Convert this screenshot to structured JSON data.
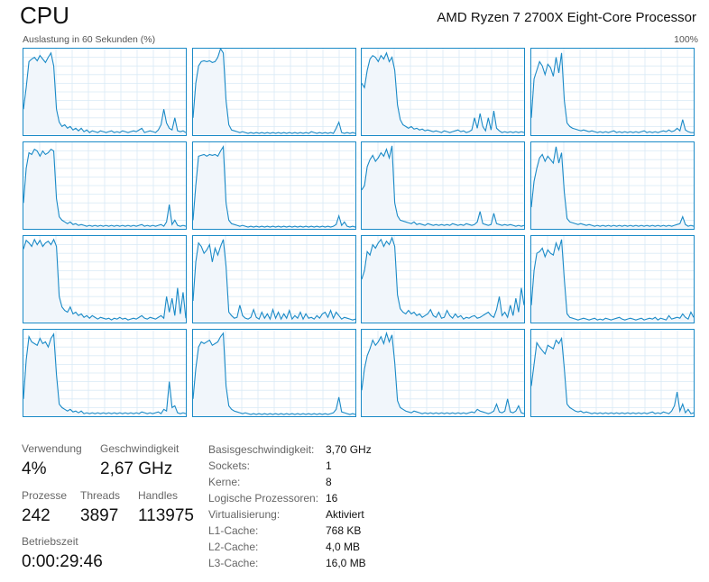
{
  "header": {
    "title": "CPU",
    "processor": "AMD Ryzen 7 2700X Eight-Core Processor",
    "axis_label": "Auslastung in 60 Sekunden (%)",
    "axis_max": "100%"
  },
  "colors": {
    "line": "#1a8ac7",
    "fill": "#f1f6fb",
    "grid": "#d9eaf5",
    "border": "#1a8ac7"
  },
  "stats": {
    "usage_label": "Verwendung",
    "usage_value": "4%",
    "speed_label": "Geschwindigkeit",
    "speed_value": "2,67 GHz",
    "processes_label": "Prozesse",
    "processes_value": "242",
    "threads_label": "Threads",
    "threads_value": "3897",
    "handles_label": "Handles",
    "handles_value": "113975",
    "uptime_label": "Betriebszeit",
    "uptime_value": "0:00:29:46"
  },
  "details": [
    {
      "label": "Basisgeschwindigkeit:",
      "value": "3,70 GHz"
    },
    {
      "label": "Sockets:",
      "value": "1"
    },
    {
      "label": "Kerne:",
      "value": "8"
    },
    {
      "label": "Logische Prozessoren:",
      "value": "16"
    },
    {
      "label": "Virtualisierung:",
      "value": "Aktiviert"
    },
    {
      "label": "L1-Cache:",
      "value": "768 KB"
    },
    {
      "label": "L2-Cache:",
      "value": "4,0 MB"
    },
    {
      "label": "L3-Cache:",
      "value": "16,0 MB"
    }
  ],
  "chart_data": {
    "type": "area",
    "ylim": [
      0,
      100
    ],
    "x_seconds": 60,
    "grid": true,
    "series": [
      {
        "values": [
          30,
          55,
          85,
          88,
          90,
          86,
          92,
          88,
          84,
          90,
          95,
          80,
          30,
          15,
          10,
          12,
          8,
          10,
          6,
          8,
          5,
          8,
          4,
          6,
          3,
          5,
          4,
          3,
          5,
          4,
          3,
          4,
          5,
          3,
          4,
          3,
          5,
          4,
          3,
          4,
          5,
          4,
          6,
          8,
          3,
          4,
          5,
          4,
          3,
          6,
          12,
          30,
          14,
          8,
          6,
          20,
          5,
          4,
          5,
          3
        ]
      },
      {
        "values": [
          20,
          60,
          80,
          85,
          86,
          85,
          86,
          84,
          85,
          90,
          100,
          95,
          40,
          12,
          6,
          5,
          4,
          3,
          4,
          3,
          2,
          3,
          2,
          3,
          2,
          3,
          2,
          3,
          2,
          3,
          2,
          3,
          2,
          3,
          2,
          3,
          2,
          3,
          2,
          3,
          2,
          3,
          2,
          4,
          3,
          2,
          3,
          2,
          3,
          2,
          3,
          2,
          8,
          15,
          3,
          2,
          3,
          2,
          3,
          2
        ]
      },
      {
        "values": [
          60,
          55,
          75,
          88,
          92,
          90,
          85,
          92,
          88,
          95,
          85,
          90,
          75,
          35,
          18,
          12,
          10,
          8,
          10,
          7,
          8,
          6,
          7,
          5,
          6,
          5,
          4,
          5,
          4,
          3,
          5,
          4,
          3,
          4,
          5,
          6,
          4,
          5,
          3,
          4,
          6,
          20,
          8,
          25,
          10,
          5,
          20,
          6,
          28,
          8,
          5,
          3,
          4,
          3,
          4,
          3,
          4,
          3,
          4,
          3
        ]
      },
      {
        "values": [
          20,
          65,
          75,
          85,
          80,
          70,
          82,
          78,
          68,
          90,
          72,
          95,
          40,
          14,
          10,
          8,
          7,
          6,
          5,
          6,
          5,
          4,
          5,
          4,
          3,
          4,
          3,
          4,
          3,
          4,
          5,
          3,
          4,
          3,
          4,
          3,
          4,
          3,
          4,
          3,
          4,
          5,
          3,
          4,
          3,
          4,
          3,
          4,
          5,
          4,
          6,
          4,
          5,
          8,
          5,
          18,
          6,
          4,
          3,
          3
        ]
      },
      {
        "values": [
          30,
          70,
          88,
          86,
          92,
          90,
          84,
          90,
          86,
          88,
          92,
          90,
          35,
          14,
          10,
          8,
          6,
          8,
          5,
          6,
          4,
          5,
          4,
          3,
          4,
          3,
          4,
          3,
          4,
          3,
          4,
          3,
          4,
          3,
          4,
          3,
          4,
          3,
          4,
          3,
          4,
          3,
          4,
          5,
          3,
          4,
          3,
          4,
          3,
          4,
          5,
          3,
          8,
          28,
          5,
          10,
          4,
          3,
          4,
          3
        ]
      },
      {
        "values": [
          10,
          50,
          84,
          85,
          86,
          84,
          86,
          85,
          86,
          84,
          90,
          95,
          30,
          10,
          6,
          5,
          4,
          3,
          4,
          3,
          2,
          3,
          2,
          3,
          2,
          3,
          2,
          3,
          2,
          3,
          2,
          3,
          2,
          3,
          2,
          3,
          2,
          3,
          2,
          3,
          2,
          3,
          2,
          3,
          2,
          3,
          2,
          3,
          2,
          3,
          2,
          3,
          5,
          15,
          4,
          8,
          3,
          2,
          3,
          2
        ]
      },
      {
        "values": [
          45,
          50,
          72,
          80,
          85,
          78,
          82,
          88,
          84,
          92,
          82,
          96,
          30,
          15,
          10,
          9,
          8,
          7,
          6,
          8,
          5,
          6,
          5,
          4,
          6,
          5,
          4,
          5,
          4,
          5,
          4,
          5,
          4,
          6,
          5,
          4,
          5,
          4,
          6,
          5,
          4,
          5,
          8,
          20,
          6,
          5,
          4,
          5,
          18,
          6,
          5,
          4,
          5,
          4,
          5,
          4,
          3,
          4,
          3,
          4
        ]
      },
      {
        "values": [
          25,
          55,
          70,
          82,
          86,
          78,
          84,
          80,
          76,
          95,
          76,
          88,
          42,
          12,
          8,
          7,
          6,
          5,
          6,
          5,
          4,
          5,
          4,
          3,
          4,
          3,
          4,
          3,
          4,
          3,
          4,
          3,
          4,
          3,
          4,
          3,
          4,
          3,
          4,
          3,
          4,
          3,
          4,
          3,
          4,
          3,
          4,
          3,
          4,
          3,
          4,
          3,
          4,
          5,
          6,
          14,
          5,
          3,
          4,
          3
        ]
      },
      {
        "values": [
          85,
          95,
          92,
          88,
          96,
          90,
          95,
          88,
          92,
          94,
          90,
          96,
          88,
          30,
          18,
          14,
          12,
          18,
          10,
          12,
          8,
          10,
          6,
          8,
          5,
          8,
          6,
          4,
          6,
          5,
          4,
          5,
          3,
          5,
          4,
          6,
          4,
          5,
          3,
          4,
          5,
          4,
          6,
          8,
          5,
          4,
          6,
          5,
          4,
          6,
          8,
          5,
          30,
          12,
          28,
          8,
          40,
          10,
          35,
          5
        ]
      },
      {
        "values": [
          25,
          70,
          92,
          88,
          80,
          84,
          90,
          70,
          86,
          78,
          88,
          96,
          65,
          12,
          8,
          5,
          6,
          20,
          8,
          5,
          4,
          6,
          15,
          6,
          4,
          12,
          5,
          10,
          4,
          15,
          5,
          12,
          4,
          10,
          5,
          14,
          4,
          8,
          5,
          12,
          4,
          10,
          5,
          6,
          4,
          8,
          5,
          10,
          12,
          6,
          14,
          5,
          12,
          8,
          4,
          6,
          5,
          4,
          3,
          4
        ]
      },
      {
        "values": [
          50,
          60,
          82,
          78,
          90,
          86,
          92,
          96,
          88,
          94,
          90,
          98,
          88,
          32,
          16,
          12,
          10,
          14,
          10,
          12,
          8,
          10,
          6,
          8,
          10,
          15,
          8,
          6,
          12,
          5,
          6,
          14,
          8,
          5,
          10,
          6,
          8,
          4,
          6,
          5,
          7,
          8,
          5,
          6,
          8,
          10,
          12,
          8,
          6,
          15,
          30,
          8,
          12,
          6,
          20,
          8,
          28,
          12,
          40,
          20
        ]
      },
      {
        "values": [
          20,
          60,
          80,
          82,
          86,
          76,
          84,
          80,
          78,
          92,
          84,
          96,
          50,
          10,
          6,
          5,
          4,
          3,
          4,
          5,
          4,
          3,
          4,
          5,
          3,
          4,
          3,
          5,
          4,
          3,
          4,
          5,
          6,
          4,
          3,
          4,
          5,
          4,
          3,
          4,
          5,
          3,
          4,
          5,
          4,
          6,
          3,
          5,
          4,
          3,
          8,
          4,
          5,
          6,
          5,
          10,
          6,
          4,
          12,
          6
        ]
      },
      {
        "values": [
          20,
          65,
          92,
          86,
          84,
          82,
          90,
          84,
          86,
          80,
          90,
          95,
          48,
          14,
          10,
          8,
          6,
          8,
          5,
          6,
          4,
          6,
          3,
          4,
          3,
          4,
          3,
          4,
          3,
          4,
          3,
          4,
          3,
          4,
          3,
          4,
          3,
          4,
          3,
          4,
          3,
          4,
          3,
          5,
          4,
          3,
          4,
          3,
          4,
          5,
          3,
          8,
          6,
          40,
          10,
          12,
          4,
          3,
          4,
          3
        ]
      },
      {
        "values": [
          20,
          55,
          80,
          86,
          84,
          86,
          88,
          82,
          84,
          86,
          92,
          96,
          35,
          12,
          8,
          6,
          5,
          4,
          3,
          4,
          3,
          2,
          3,
          2,
          3,
          2,
          3,
          2,
          3,
          2,
          3,
          2,
          3,
          2,
          3,
          2,
          3,
          2,
          3,
          2,
          3,
          2,
          3,
          2,
          3,
          2,
          3,
          2,
          3,
          2,
          3,
          4,
          8,
          22,
          5,
          4,
          3,
          2,
          3,
          2
        ]
      },
      {
        "values": [
          30,
          55,
          70,
          78,
          88,
          82,
          86,
          92,
          84,
          96,
          86,
          94,
          62,
          18,
          10,
          8,
          6,
          5,
          4,
          6,
          5,
          4,
          3,
          4,
          3,
          4,
          3,
          4,
          3,
          4,
          3,
          4,
          3,
          4,
          3,
          4,
          3,
          4,
          3,
          4,
          5,
          4,
          8,
          6,
          5,
          4,
          3,
          4,
          6,
          14,
          5,
          4,
          6,
          20,
          5,
          4,
          6,
          12,
          4,
          3
        ]
      },
      {
        "values": [
          35,
          60,
          85,
          80,
          76,
          72,
          82,
          80,
          78,
          88,
          84,
          90,
          55,
          14,
          10,
          8,
          6,
          5,
          6,
          4,
          5,
          4,
          3,
          4,
          3,
          4,
          3,
          4,
          3,
          4,
          3,
          4,
          3,
          4,
          3,
          4,
          3,
          4,
          3,
          4,
          3,
          4,
          3,
          4,
          5,
          3,
          4,
          3,
          5,
          4,
          3,
          6,
          12,
          28,
          6,
          14,
          4,
          8,
          3,
          4
        ]
      }
    ]
  }
}
